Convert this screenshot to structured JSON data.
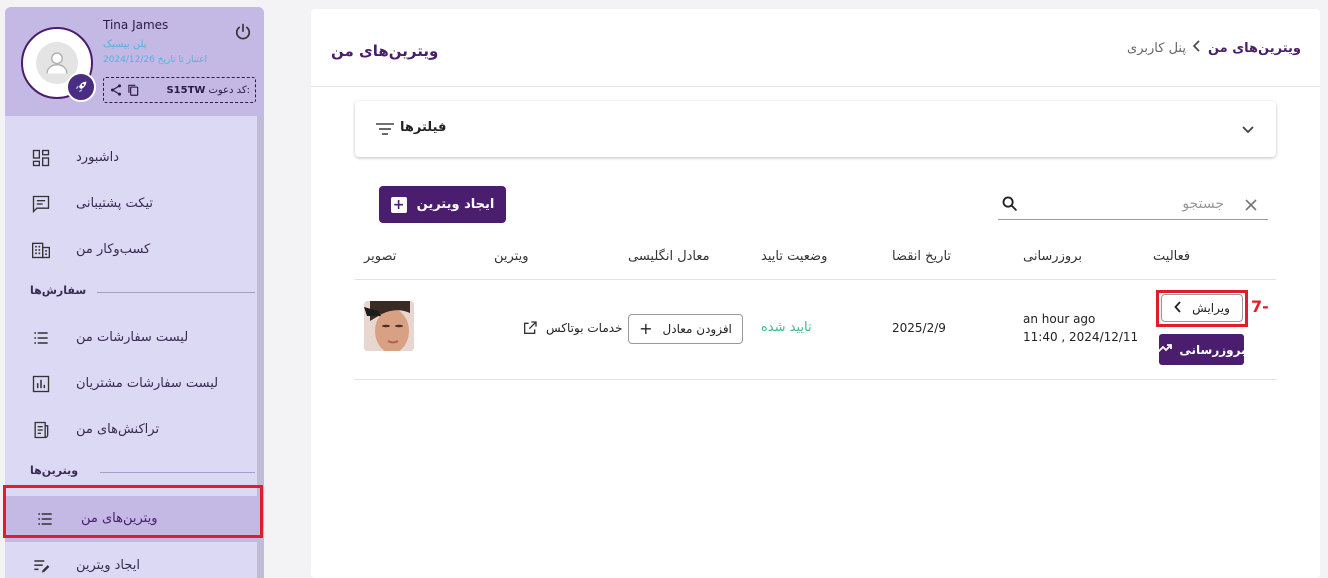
{
  "colors": {
    "brand": "#4a1d6e",
    "sidebar": "#dcd9f4",
    "success": "#3fb98b",
    "highlight": "#e21d2b"
  },
  "profile": {
    "name": "Tina James",
    "plan": "پلن بیسیک",
    "validity": "اعتبار تا تاریخ 2024/12/26",
    "invite_label": ":کد دعوت",
    "invite_code": "S15TW"
  },
  "nav": {
    "dashboard": "داشبورد",
    "support_ticket": "تیکت پشتیبانی",
    "my_business": "کسب‌وکار من",
    "section_orders": "سفارش‌ها",
    "my_orders": "لیست سفارشات من",
    "customer_orders": "لیست سفارشات مشتریان",
    "my_transactions": "تراکنش‌های من",
    "section_showcases": "ویترین‌ها",
    "my_showcases": "ویترین‌های من",
    "create_showcase": "ایجاد ویترین"
  },
  "header": {
    "title": "ویترین‌های من",
    "breadcrumb": [
      "ویترین‌های من",
      "پنل کاربری"
    ]
  },
  "filters": {
    "title": "فیلترها"
  },
  "toolbar": {
    "create_label": "ایجاد ویترین",
    "search_placeholder": "جستجو"
  },
  "table": {
    "headers": {
      "activity": "فعالیت",
      "updated": "بروزرسانی",
      "expire": "تاریخ انقضا",
      "status": "وضعیت تایید",
      "english": "معادل انگلیسی",
      "showcase": "ویترین",
      "image": "تصویر"
    },
    "rows": [
      {
        "name": "خدمات بوتاکس",
        "add_equivalent": "افزودن معادل",
        "status": "تایید شده",
        "expire": "2025/2/9",
        "updated_relative": "an hour ago",
        "updated_abs": "11:40 , 2024/12/11",
        "edit": "ویرایش",
        "update": "بروزرسانی"
      }
    ]
  },
  "annotation": {
    "step": "7-"
  }
}
